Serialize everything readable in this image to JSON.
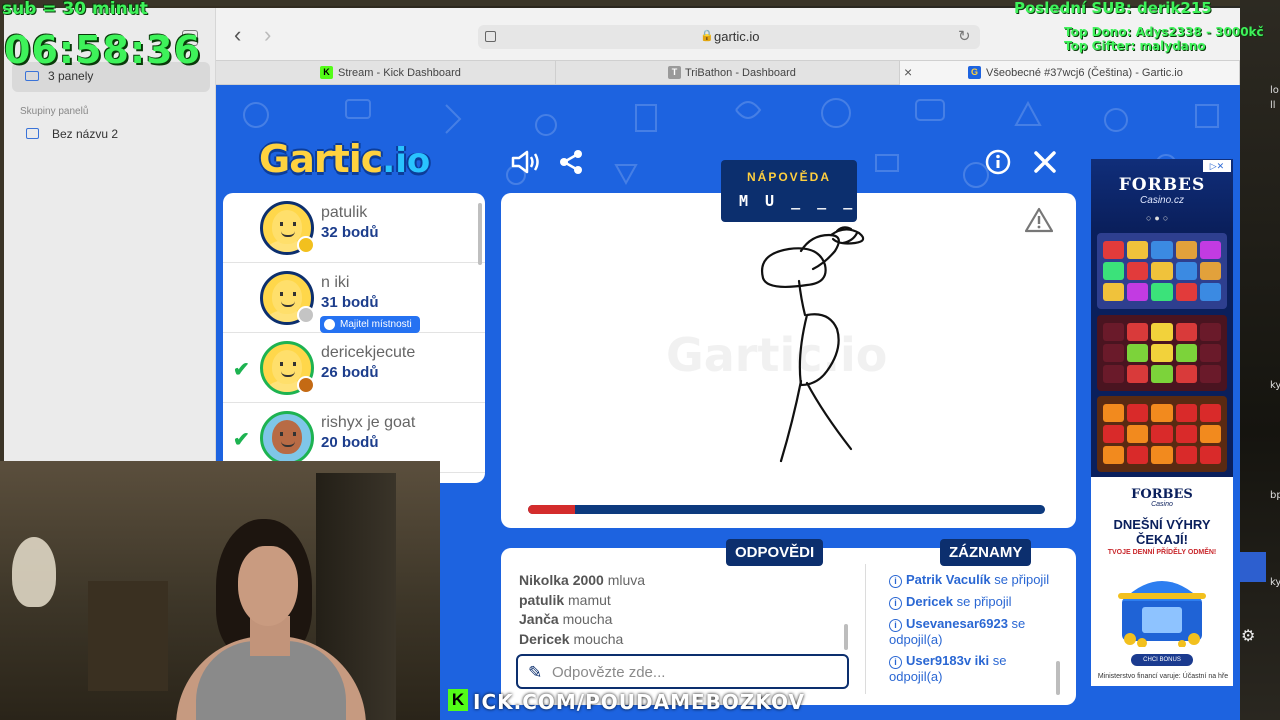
{
  "overlay": {
    "sub_rule": "sub = 30 minut",
    "timer": "06:58:36",
    "last_sub": "Poslední SUB: derik215",
    "top_donor": "Top Dono: Adys2338 - 3000kč",
    "top_gifter": "Top Gifter: malydano"
  },
  "sidebar": {
    "tab_groups": "3 panely",
    "section": "Skupiny panelů",
    "group": "Bez názvu 2"
  },
  "browser": {
    "url": "gartic.io",
    "tabs": [
      {
        "title": "Stream - Kick Dashboard",
        "favicon": "K"
      },
      {
        "title": "TriBathon - Dashboard",
        "favicon": "T"
      },
      {
        "title": "Všeobecné #37wcj6 (Čeština) - Gartic.io",
        "favicon": "G"
      }
    ]
  },
  "game": {
    "logo": "Gartic",
    "logo_suffix": ".io",
    "hint_title": "NÁPOVĚDA",
    "hint_letters": "M U _ _ _ _ _ _",
    "watermark": "Gartic.io",
    "timer_progress": 0.09,
    "players": [
      {
        "name": "patulik",
        "points": "32 bodů",
        "medal": "#f2c01e",
        "guessed": false
      },
      {
        "name": "n iki",
        "points": "31 bodů",
        "medal": "#c4c4c4",
        "guessed": false,
        "badge": "Majitel místnosti"
      },
      {
        "name": "dericekjecute",
        "points": "26 bodů",
        "medal": "#c46a14",
        "guessed": true
      },
      {
        "name": "rishyx je goat",
        "points": "20 bodů",
        "guessed": true
      }
    ],
    "answers_label": "ODPOVĚDI",
    "logs_label": "ZÁZNAMY",
    "answers": [
      {
        "user": "Nikolka 2000",
        "word": "mluva"
      },
      {
        "user": "patulik",
        "word": "mamut"
      },
      {
        "user": "Janča",
        "word": "moucha"
      },
      {
        "user": "Dericek",
        "word": "moucha"
      }
    ],
    "answer_placeholder": "Odpovězte zde...",
    "logs": [
      {
        "user": "Patrik Vaculík",
        "text": "se připojil"
      },
      {
        "user": "Dericek",
        "text": "se připojil"
      },
      {
        "user": "Usevanesar6923",
        "text": "se odpojil(a)"
      },
      {
        "user": "User9183v iki",
        "text": "se odpojil(a)"
      }
    ]
  },
  "ad": {
    "brand": "FORBES",
    "sub": "Casino.cz",
    "brand2": "FORBES",
    "sub2": "Casino",
    "headline": "DNEŠNÍ VÝHRY ČEKAJÍ!",
    "small": "TVOJE DENNÍ PŘÍDĚLY ODMĚN!",
    "button": "CHCI BONUS",
    "footer": "Ministerstvo financí varuje: Účastní na hře"
  },
  "kick_banner": {
    "logo": "K",
    "text": "ICK.COM/POUDAMEBOZKOV"
  }
}
